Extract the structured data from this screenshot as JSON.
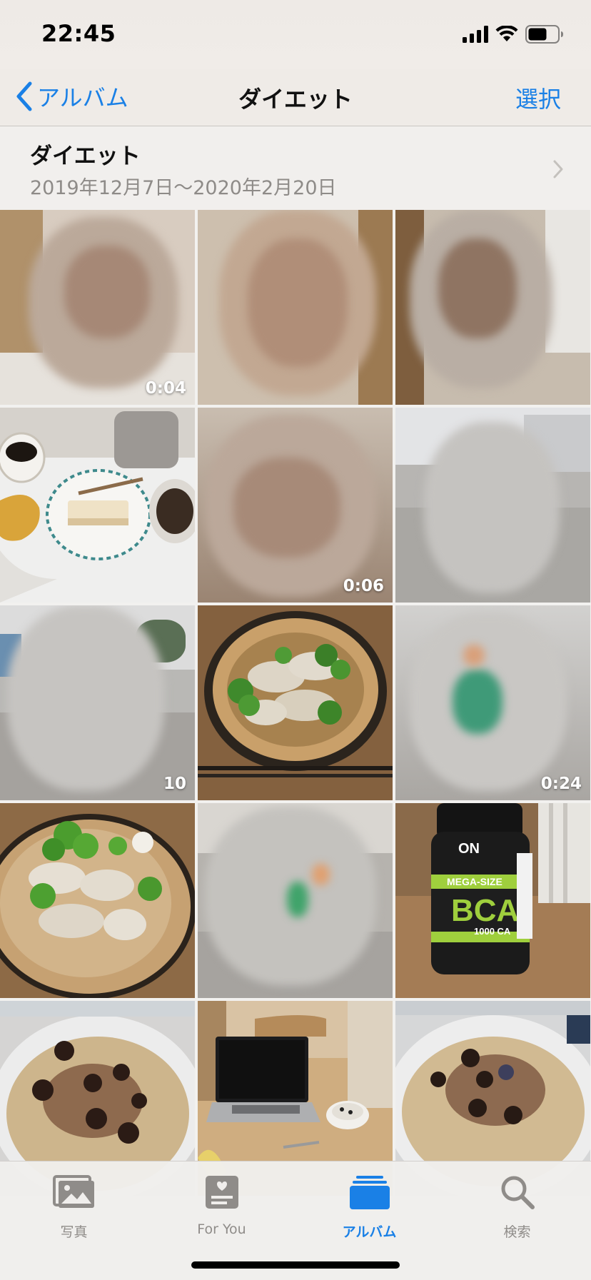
{
  "status_bar": {
    "time": "22:45",
    "icons": [
      "signal-icon",
      "wifi-icon",
      "battery-icon"
    ]
  },
  "nav": {
    "back_label": "アルバム",
    "title": "ダイエット",
    "select_label": "選択"
  },
  "album": {
    "name": "ダイエット",
    "date_range": "2019年12月7日〜2020年2月20日"
  },
  "grid": {
    "items": [
      {
        "kind": "video",
        "content": "blurred-person",
        "duration": "0:04"
      },
      {
        "kind": "photo",
        "content": "blurred-person",
        "duration": ""
      },
      {
        "kind": "photo",
        "content": "blurred-person",
        "duration": ""
      },
      {
        "kind": "photo",
        "content": "coffee-and-bread",
        "duration": ""
      },
      {
        "kind": "video",
        "content": "blurred-person",
        "duration": "0:06"
      },
      {
        "kind": "photo",
        "content": "blurred-outdoor",
        "duration": ""
      },
      {
        "kind": "video",
        "content": "blurred-outdoor",
        "duration": "10"
      },
      {
        "kind": "photo",
        "content": "chicken-broccoli-plate",
        "duration": ""
      },
      {
        "kind": "video",
        "content": "blurred-outdoor-green",
        "duration": "0:24"
      },
      {
        "kind": "photo",
        "content": "chicken-broccoli-plate",
        "duration": ""
      },
      {
        "kind": "photo",
        "content": "blurred-outdoor-green",
        "duration": ""
      },
      {
        "kind": "photo",
        "content": "supplement-bottle",
        "duration": ""
      },
      {
        "kind": "photo",
        "content": "oatmeal-bowl",
        "duration": ""
      },
      {
        "kind": "photo",
        "content": "laptop-on-table",
        "duration": ""
      },
      {
        "kind": "photo",
        "content": "oatmeal-bowl",
        "duration": ""
      }
    ]
  },
  "tabs": [
    {
      "label": "写真",
      "icon": "photos-icon",
      "active": false
    },
    {
      "label": "For You",
      "icon": "for-you-icon",
      "active": false
    },
    {
      "label": "アルバム",
      "icon": "albums-icon",
      "active": true
    },
    {
      "label": "検索",
      "icon": "search-icon",
      "active": false
    }
  ],
  "colors": {
    "accent": "#1a80e6",
    "inactive_tab": "#8f8c89"
  }
}
